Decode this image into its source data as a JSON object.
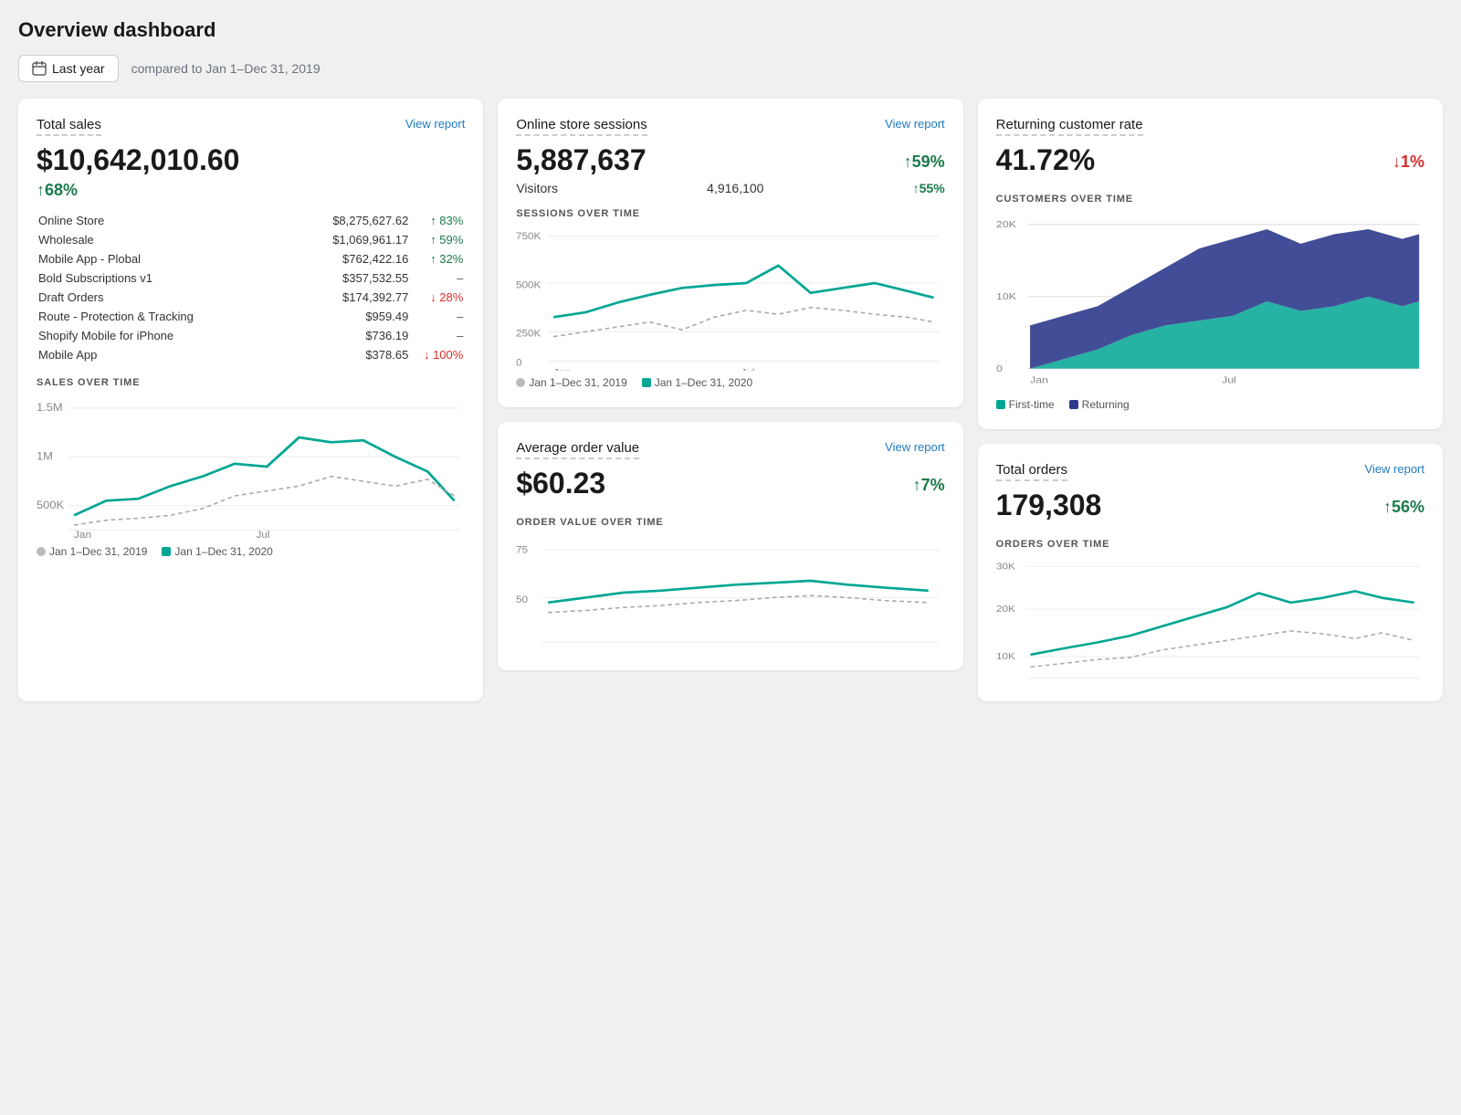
{
  "page": {
    "title": "Overview dashboard"
  },
  "datebar": {
    "button_label": "Last year",
    "compare_text": "compared to Jan 1–Dec 31, 2019"
  },
  "total_sales": {
    "title": "Total sales",
    "view_report": "View report",
    "main_value": "$10,642,010.60",
    "pct_change": "68%",
    "pct_direction": "up",
    "rows": [
      {
        "name": "Online Store",
        "value": "$8,275,627.62",
        "pct": "83%",
        "dir": "up"
      },
      {
        "name": "Wholesale",
        "value": "$1,069,961.17",
        "pct": "59%",
        "dir": "up"
      },
      {
        "name": "Mobile App - Plobal",
        "value": "$762,422.16",
        "pct": "32%",
        "dir": "up"
      },
      {
        "name": "Bold Subscriptions v1",
        "value": "$357,532.55",
        "pct": "–",
        "dir": "none"
      },
      {
        "name": "Draft Orders",
        "value": "$174,392.77",
        "pct": "28%",
        "dir": "down"
      },
      {
        "name": "Route - Protection & Tracking",
        "value": "$959.49",
        "pct": "–",
        "dir": "none"
      },
      {
        "name": "Shopify Mobile for iPhone",
        "value": "$736.19",
        "pct": "–",
        "dir": "none"
      },
      {
        "name": "Mobile App",
        "value": "$378.65",
        "pct": "100%",
        "dir": "down"
      }
    ],
    "chart_label": "SALES OVER TIME",
    "legend_2019": "Jan 1–Dec 31, 2019",
    "legend_2020": "Jan 1–Dec 31, 2020"
  },
  "online_sessions": {
    "title": "Online store sessions",
    "view_report": "View report",
    "main_value": "5,887,637",
    "pct_change": "59%",
    "pct_direction": "up",
    "visitors_label": "Visitors",
    "visitors_value": "4,916,100",
    "visitors_pct": "55%",
    "visitors_dir": "up",
    "chart_label": "SESSIONS OVER TIME",
    "legend_2019": "Jan 1–Dec 31, 2019",
    "legend_2020": "Jan 1–Dec 31, 2020"
  },
  "returning_customer": {
    "title": "Returning customer rate",
    "main_value": "41.72%",
    "pct_change": "1%",
    "pct_direction": "down",
    "chart_label": "CUSTOMERS OVER TIME",
    "legend_first_time": "First-time",
    "legend_returning": "Returning"
  },
  "avg_order": {
    "title": "Average order value",
    "view_report": "View report",
    "main_value": "$60.23",
    "pct_change": "7%",
    "pct_direction": "up",
    "chart_label": "ORDER VALUE OVER TIME"
  },
  "total_orders": {
    "title": "Total orders",
    "view_report": "View report",
    "main_value": "179,308",
    "pct_change": "56%",
    "pct_direction": "up",
    "chart_label": "ORDERS OVER TIME"
  }
}
